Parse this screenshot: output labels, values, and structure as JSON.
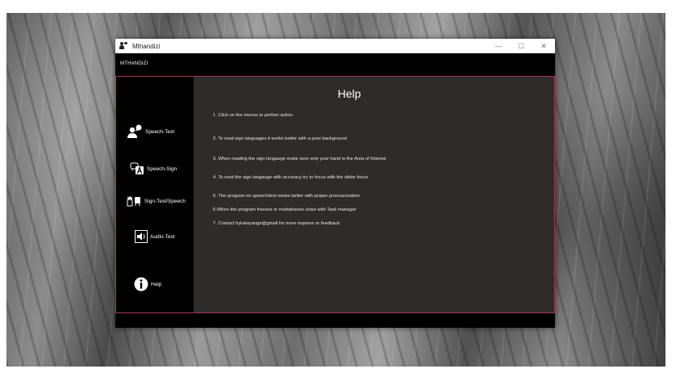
{
  "window": {
    "title": "Mthandizi",
    "controls": {
      "minimize": "—",
      "maximize": "☐",
      "close": "✕"
    }
  },
  "menubar": {
    "title": "MTHANDIZI"
  },
  "sidebar": {
    "items": [
      {
        "label": "Speech-Text",
        "icon": "speaking-person-icon"
      },
      {
        "label": "Speech-Sign",
        "icon": "speech-sign-icon"
      },
      {
        "label": "Sign-Text/Speech",
        "icon": "hands-icon"
      },
      {
        "label": "Audio-Text",
        "icon": "audio-icon"
      },
      {
        "label": "Help",
        "icon": "info-icon"
      }
    ]
  },
  "help": {
    "title": "Help",
    "lines": [
      "1. Click on the menus to perfom action",
      "2. To read sign languages it works better with a pure background",
      "3. When reading the sign langauge make sure only your hand is the Area of Interest",
      "4. To read the sign langauge with accuracy try to focus with the slider focus",
      "5. The program on speech/text works better with proper pronounciation",
      "6.When the program freezes or misbahaves close with Task manager",
      "7. Contact hylukayange@gmail for more inquires or feedback"
    ]
  },
  "colors": {
    "accent_border": "#a8325a",
    "panel_bg": "#2f2b2b",
    "sidebar_bg": "#000000"
  }
}
